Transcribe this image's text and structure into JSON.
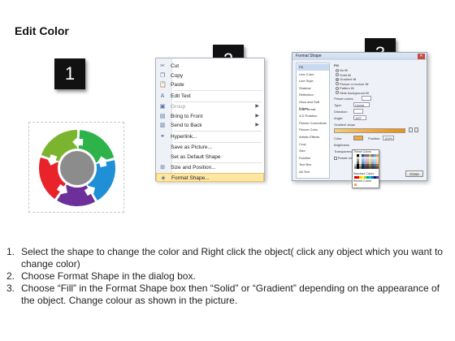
{
  "title": "Edit Color",
  "badges": [
    "1",
    "2",
    "3"
  ],
  "colors": {
    "donut": [
      "#e8232a",
      "#7bb52f",
      "#2db34a",
      "#1f8fd6",
      "#6d2f99",
      "#8a8a8a"
    ],
    "highlight": "#fde7a2"
  },
  "context_menu": {
    "items": [
      {
        "label": "Cut",
        "icon": "scissors-icon",
        "glyph": "✂",
        "enabled": true
      },
      {
        "label": "Copy",
        "icon": "copy-icon",
        "glyph": "❐",
        "enabled": true
      },
      {
        "label": "Paste",
        "icon": "paste-icon",
        "glyph": "📋",
        "enabled": true
      },
      {
        "label": "Edit Text",
        "icon": "edit-text-icon",
        "glyph": "A",
        "enabled": true
      },
      {
        "label": "Group",
        "icon": "group-icon",
        "glyph": "▣",
        "enabled": false,
        "submenu": true
      },
      {
        "label": "Bring to Front",
        "icon": "bring-front-icon",
        "glyph": "▤",
        "enabled": true,
        "submenu": true
      },
      {
        "label": "Send to Back",
        "icon": "send-back-icon",
        "glyph": "▥",
        "enabled": true,
        "submenu": true
      },
      {
        "label": "Hyperlink...",
        "icon": "hyperlink-icon",
        "glyph": "⚭",
        "enabled": true
      },
      {
        "label": "Save as Picture...",
        "icon": "save-picture-icon",
        "glyph": "",
        "enabled": true
      },
      {
        "label": "Set as Default Shape",
        "icon": "default-shape-icon",
        "glyph": "",
        "enabled": true
      },
      {
        "label": "Size and Position...",
        "icon": "size-position-icon",
        "glyph": "⊞",
        "enabled": true
      },
      {
        "label": "Format Shape...",
        "icon": "format-shape-icon",
        "glyph": "◈",
        "enabled": true,
        "highlighted": true
      }
    ]
  },
  "dialog": {
    "title": "Format Shape",
    "close_label": "Close",
    "categories": [
      "Fill",
      "Line Color",
      "Line Style",
      "Shadow",
      "Reflection",
      "Glow and Soft Edges",
      "3-D Format",
      "3-D Rotation",
      "Picture Corrections",
      "Picture Color",
      "Artistic Effects",
      "Crop",
      "Size",
      "Position",
      "Text Box",
      "Alt Text"
    ],
    "fill_heading": "Fill",
    "fill_options": [
      "No fill",
      "Solid fill",
      "Gradient fill",
      "Picture or texture fill",
      "Pattern fill",
      "Slide background fill"
    ],
    "preset_label": "Preset colors:",
    "type_label": "Type:",
    "type_value": "Linear",
    "direction_label": "Direction:",
    "angle_label": "Angle:",
    "angle_value": "120°",
    "stops_label": "Gradient stops",
    "color_label": "Color",
    "position_label": "Position:",
    "position_value": "100%",
    "brightness_label": "Brightness",
    "transparency_label": "Transparency",
    "rotate_label": "Rotate with shape",
    "palette_theme": "Theme Colors",
    "palette_standard": "Standard Colors",
    "palette_recent": "Recent Colors"
  },
  "instructions": [
    {
      "num": "1.",
      "text": "Select the shape to change the color and Right click the object( click any object which you want to change color)"
    },
    {
      "num": "2.",
      "text": "Choose Format Shape in the dialog box."
    },
    {
      "num": "3.",
      "text": "Choose “Fill” in the Format Shape box then “Solid” or “Gradient” depending on the appearance of the object. Change colour as shown in the picture."
    }
  ]
}
